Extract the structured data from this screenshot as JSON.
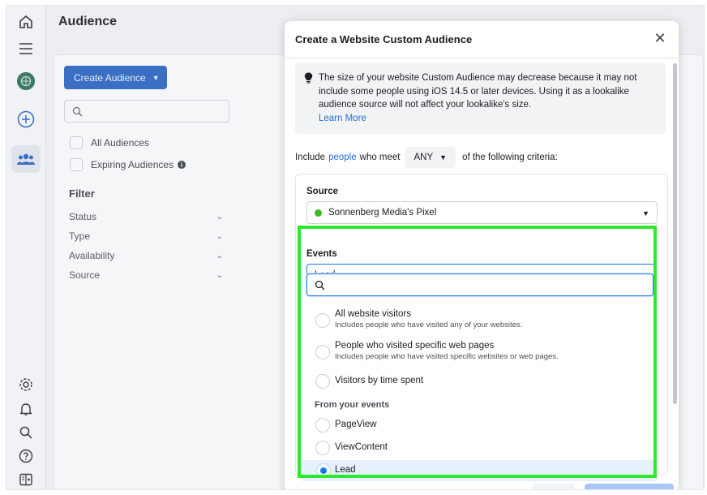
{
  "page": {
    "title": "Audience"
  },
  "rail": {
    "icons": [
      "home-icon",
      "menu-icon",
      "brand-logo-icon",
      "add-circle-icon",
      "audience-icon",
      "settings-icon",
      "bell-icon",
      "search-icon",
      "help-icon",
      "sidebar-toggle-icon"
    ]
  },
  "left_panel": {
    "create_label": "Create Audience",
    "search_placeholder": "",
    "checkboxes": [
      {
        "label": "All Audiences"
      },
      {
        "label": "Expiring Audiences"
      }
    ],
    "filter_title": "Filter",
    "filters": [
      {
        "label": "Status"
      },
      {
        "label": "Type"
      },
      {
        "label": "Availability"
      },
      {
        "label": "Source"
      }
    ]
  },
  "modal": {
    "title": "Create a Website Custom Audience",
    "info": {
      "text": "The size of your website Custom Audience may decrease because it may not include some people using iOS 14.5 or later devices. Using it as a lookalike audience source will not affect your lookalike's size.",
      "link": "Learn More"
    },
    "criteria": {
      "prefix": "Include",
      "link": "people",
      "middle": "who meet",
      "match": "ANY",
      "suffix": "of the following criteria:"
    },
    "source": {
      "label": "Source",
      "value": "Sonnenberg Media's Pixel",
      "status_color": "#42b72a"
    },
    "events": {
      "label": "Events",
      "value": "Lead",
      "search_placeholder": "",
      "options": [
        {
          "title": "All website visitors",
          "subtitle": "Includes people who have visited any of your websites."
        },
        {
          "title": "People who visited specific web pages",
          "subtitle": "Includes people who have visited specific websites or web pages."
        },
        {
          "title": "Visitors by time spent",
          "subtitle": ""
        }
      ],
      "group_title": "From your events",
      "event_options": [
        {
          "title": "PageView",
          "selected": false
        },
        {
          "title": "ViewContent",
          "selected": false
        },
        {
          "title": "Lead",
          "selected": true
        }
      ]
    },
    "highlight_color": "#2ee82e"
  }
}
